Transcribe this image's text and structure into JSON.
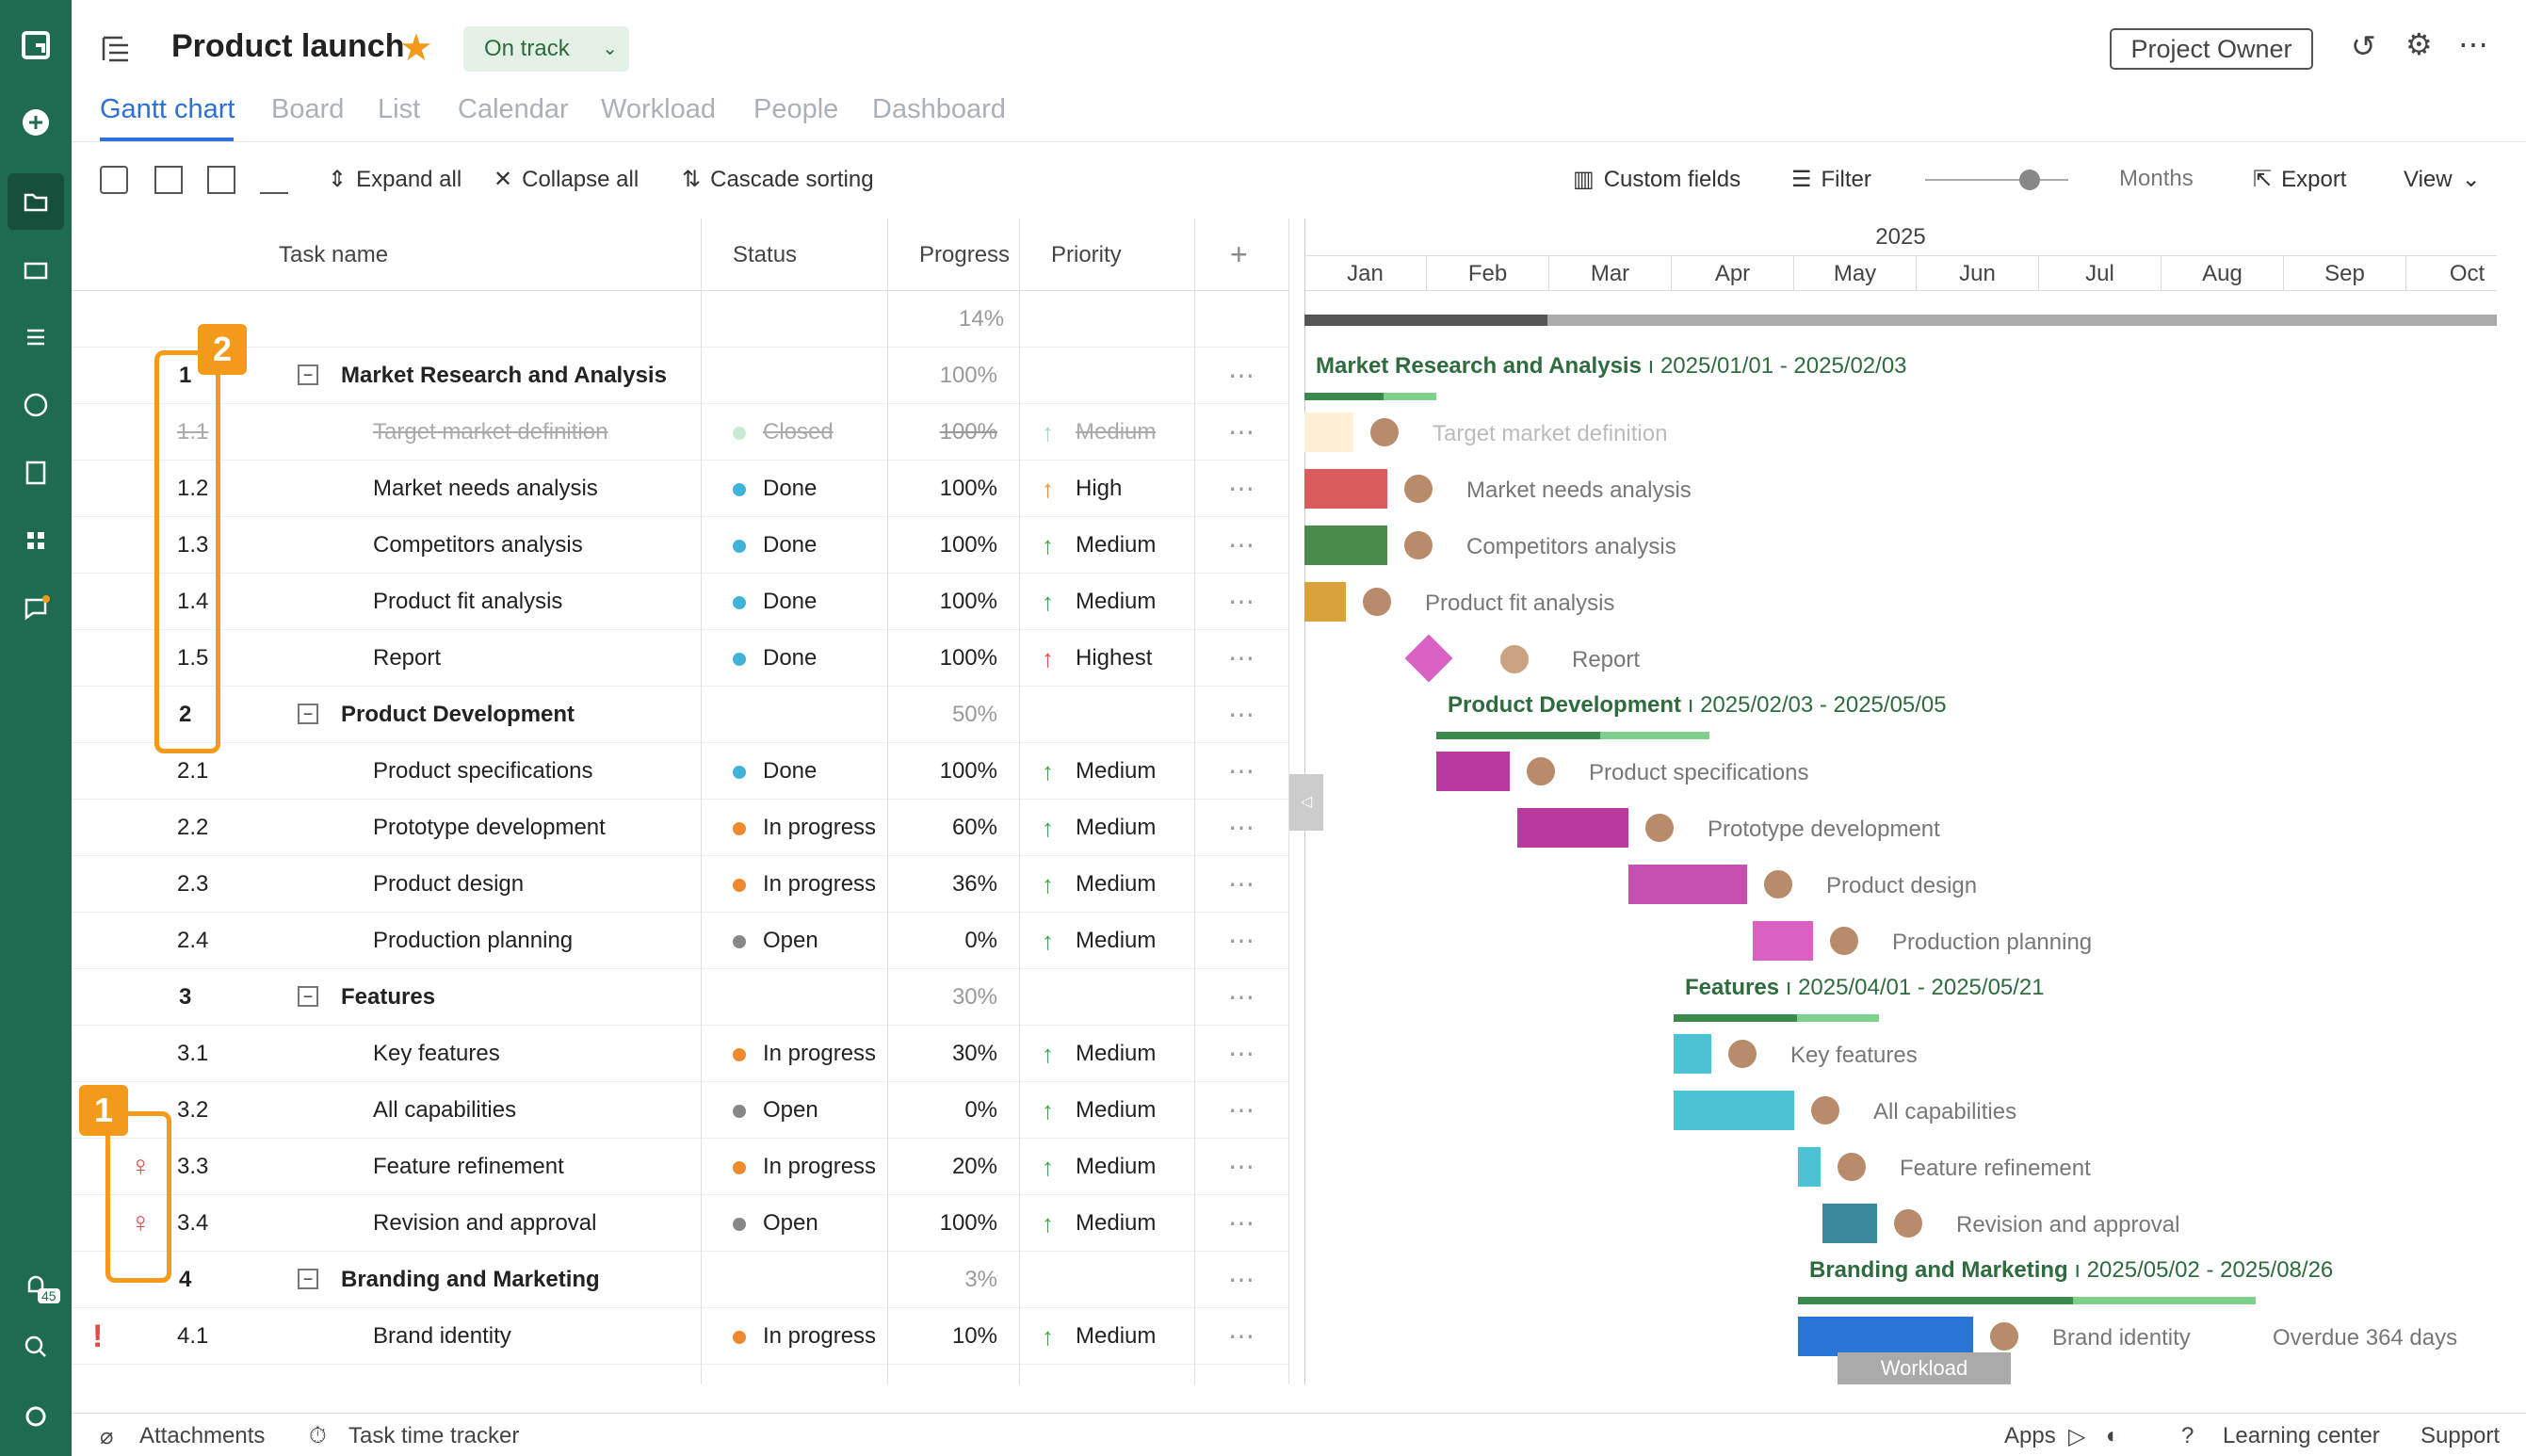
{
  "header": {
    "title": "Product launch",
    "status": "On track",
    "owner_button": "Project Owner"
  },
  "tabs": [
    "Gantt chart",
    "Board",
    "List",
    "Calendar",
    "Workload",
    "People",
    "Dashboard"
  ],
  "toolbar": {
    "expand": "Expand all",
    "collapse": "Collapse all",
    "cascade": "Cascade sorting",
    "custom_fields": "Custom fields",
    "filter": "Filter",
    "zoom": "Months",
    "export": "Export",
    "view": "View"
  },
  "columns": {
    "task": "Task name",
    "status": "Status",
    "progress": "Progress",
    "priority": "Priority"
  },
  "summary_progress": "14%",
  "rows": [
    {
      "id": "1",
      "name": "Market Research and Analysis",
      "status": "",
      "progress": "100%",
      "priority": "",
      "group": true
    },
    {
      "id": "1.1",
      "name": "Target market definition",
      "status": "Closed",
      "progress": "100%",
      "priority": "Medium",
      "closed": true
    },
    {
      "id": "1.2",
      "name": "Market needs analysis",
      "status": "Done",
      "progress": "100%",
      "priority": "High"
    },
    {
      "id": "1.3",
      "name": "Competitors analysis",
      "status": "Done",
      "progress": "100%",
      "priority": "Medium"
    },
    {
      "id": "1.4",
      "name": "Product fit analysis",
      "status": "Done",
      "progress": "100%",
      "priority": "Medium"
    },
    {
      "id": "1.5",
      "name": "Report",
      "status": "Done",
      "progress": "100%",
      "priority": "Highest"
    },
    {
      "id": "2",
      "name": "Product Development",
      "status": "",
      "progress": "50%",
      "priority": "",
      "group": true
    },
    {
      "id": "2.1",
      "name": "Product specifications",
      "status": "Done",
      "progress": "100%",
      "priority": "Medium"
    },
    {
      "id": "2.2",
      "name": "Prototype development",
      "status": "In progress",
      "progress": "60%",
      "priority": "Medium"
    },
    {
      "id": "2.3",
      "name": "Product design",
      "status": "In progress",
      "progress": "36%",
      "priority": "Medium"
    },
    {
      "id": "2.4",
      "name": "Production planning",
      "status": "Open",
      "progress": "0%",
      "priority": "Medium"
    },
    {
      "id": "3",
      "name": "Features",
      "status": "",
      "progress": "30%",
      "priority": "",
      "group": true
    },
    {
      "id": "3.1",
      "name": "Key features",
      "status": "In progress",
      "progress": "30%",
      "priority": "Medium"
    },
    {
      "id": "3.2",
      "name": "All capabilities",
      "status": "Open",
      "progress": "0%",
      "priority": "Medium"
    },
    {
      "id": "3.3",
      "name": "Feature refinement",
      "status": "In progress",
      "progress": "20%",
      "priority": "Medium"
    },
    {
      "id": "3.4",
      "name": "Revision and approval",
      "status": "Open",
      "progress": "100%",
      "priority": "Medium"
    },
    {
      "id": "4",
      "name": "Branding and Marketing",
      "status": "",
      "progress": "3%",
      "priority": "",
      "group": true
    },
    {
      "id": "4.1",
      "name": "Brand identity",
      "status": "In progress",
      "progress": "10%",
      "priority": "Medium"
    }
  ],
  "gantt": {
    "year": "2025",
    "months": [
      "Jan",
      "Feb",
      "Mar",
      "Apr",
      "May",
      "Jun",
      "Jul",
      "Aug",
      "Sep",
      "Oct"
    ],
    "groups": [
      {
        "name": "Market Research and Analysis",
        "dates": "2025/01/01 - 2025/02/03"
      },
      {
        "name": "Product Development",
        "dates": "2025/02/03 - 2025/05/05"
      },
      {
        "name": "Features",
        "dates": "2025/04/01 - 2025/05/21"
      },
      {
        "name": "Branding and Marketing",
        "dates": "2025/05/02 - 2025/08/26"
      }
    ],
    "overdue": "Overdue 364 days",
    "workload": "Workload"
  },
  "footer": {
    "attachments": "Attachments",
    "tracker": "Task time tracker",
    "apps": "Apps",
    "learning": "Learning center",
    "support": "Support"
  },
  "annotations": [
    "1",
    "2"
  ],
  "notification_count": "45"
}
